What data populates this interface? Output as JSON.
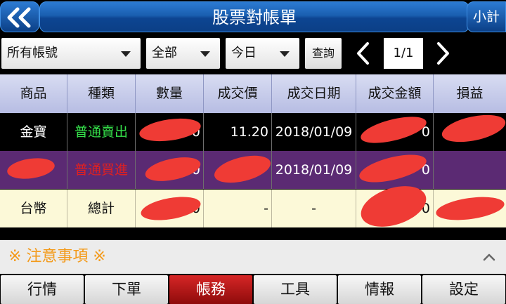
{
  "header": {
    "title": "股票對帳單",
    "subtotal_label": "小計",
    "back_icon": "double-chevron-left-icon"
  },
  "filters": {
    "account": "所有帳號",
    "type": "全部",
    "date_range": "今日",
    "query_label": "查詢",
    "page_indicator": "1/1"
  },
  "table": {
    "columns": [
      "商品",
      "種類",
      "數量",
      "成交價",
      "成交日期",
      "成交金額",
      "損益"
    ],
    "rows": [
      {
        "product": "金寶",
        "kind": "普通賣出",
        "quantity": "0",
        "price": "11.20",
        "date": "2018/01/09",
        "amount": "0",
        "pl": ""
      },
      {
        "product": "",
        "kind": "普通買進",
        "quantity": "0",
        "price": "",
        "date": "2018/01/09",
        "amount": "0",
        "pl": ""
      },
      {
        "product": "台幣",
        "kind": "總計",
        "quantity": "0",
        "price": "-",
        "date": "-",
        "amount": "0",
        "pl": ""
      }
    ]
  },
  "notes": {
    "title": "※ 注意事項 ※"
  },
  "bottom_nav": [
    "行情",
    "下單",
    "帳務",
    "工具",
    "情報",
    "設定"
  ],
  "colors": {
    "accent_blue": "#1a5fb0",
    "sell_green": "#35e04a",
    "buy_red": "#e02020",
    "active_tab": "#b81616",
    "notes_orange": "#f39a1a"
  }
}
